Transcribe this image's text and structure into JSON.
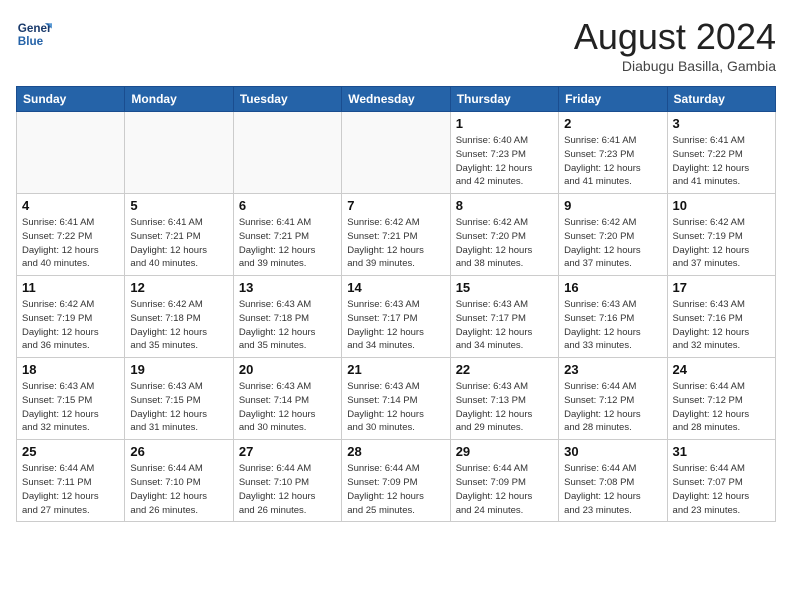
{
  "header": {
    "logo_line1": "General",
    "logo_line2": "Blue",
    "month_year": "August 2024",
    "location": "Diabugu Basilla, Gambia"
  },
  "weekdays": [
    "Sunday",
    "Monday",
    "Tuesday",
    "Wednesday",
    "Thursday",
    "Friday",
    "Saturday"
  ],
  "weeks": [
    [
      {
        "day": "",
        "info": ""
      },
      {
        "day": "",
        "info": ""
      },
      {
        "day": "",
        "info": ""
      },
      {
        "day": "",
        "info": ""
      },
      {
        "day": "1",
        "info": "Sunrise: 6:40 AM\nSunset: 7:23 PM\nDaylight: 12 hours\nand 42 minutes."
      },
      {
        "day": "2",
        "info": "Sunrise: 6:41 AM\nSunset: 7:23 PM\nDaylight: 12 hours\nand 41 minutes."
      },
      {
        "day": "3",
        "info": "Sunrise: 6:41 AM\nSunset: 7:22 PM\nDaylight: 12 hours\nand 41 minutes."
      }
    ],
    [
      {
        "day": "4",
        "info": "Sunrise: 6:41 AM\nSunset: 7:22 PM\nDaylight: 12 hours\nand 40 minutes."
      },
      {
        "day": "5",
        "info": "Sunrise: 6:41 AM\nSunset: 7:21 PM\nDaylight: 12 hours\nand 40 minutes."
      },
      {
        "day": "6",
        "info": "Sunrise: 6:41 AM\nSunset: 7:21 PM\nDaylight: 12 hours\nand 39 minutes."
      },
      {
        "day": "7",
        "info": "Sunrise: 6:42 AM\nSunset: 7:21 PM\nDaylight: 12 hours\nand 39 minutes."
      },
      {
        "day": "8",
        "info": "Sunrise: 6:42 AM\nSunset: 7:20 PM\nDaylight: 12 hours\nand 38 minutes."
      },
      {
        "day": "9",
        "info": "Sunrise: 6:42 AM\nSunset: 7:20 PM\nDaylight: 12 hours\nand 37 minutes."
      },
      {
        "day": "10",
        "info": "Sunrise: 6:42 AM\nSunset: 7:19 PM\nDaylight: 12 hours\nand 37 minutes."
      }
    ],
    [
      {
        "day": "11",
        "info": "Sunrise: 6:42 AM\nSunset: 7:19 PM\nDaylight: 12 hours\nand 36 minutes."
      },
      {
        "day": "12",
        "info": "Sunrise: 6:42 AM\nSunset: 7:18 PM\nDaylight: 12 hours\nand 35 minutes."
      },
      {
        "day": "13",
        "info": "Sunrise: 6:43 AM\nSunset: 7:18 PM\nDaylight: 12 hours\nand 35 minutes."
      },
      {
        "day": "14",
        "info": "Sunrise: 6:43 AM\nSunset: 7:17 PM\nDaylight: 12 hours\nand 34 minutes."
      },
      {
        "day": "15",
        "info": "Sunrise: 6:43 AM\nSunset: 7:17 PM\nDaylight: 12 hours\nand 34 minutes."
      },
      {
        "day": "16",
        "info": "Sunrise: 6:43 AM\nSunset: 7:16 PM\nDaylight: 12 hours\nand 33 minutes."
      },
      {
        "day": "17",
        "info": "Sunrise: 6:43 AM\nSunset: 7:16 PM\nDaylight: 12 hours\nand 32 minutes."
      }
    ],
    [
      {
        "day": "18",
        "info": "Sunrise: 6:43 AM\nSunset: 7:15 PM\nDaylight: 12 hours\nand 32 minutes."
      },
      {
        "day": "19",
        "info": "Sunrise: 6:43 AM\nSunset: 7:15 PM\nDaylight: 12 hours\nand 31 minutes."
      },
      {
        "day": "20",
        "info": "Sunrise: 6:43 AM\nSunset: 7:14 PM\nDaylight: 12 hours\nand 30 minutes."
      },
      {
        "day": "21",
        "info": "Sunrise: 6:43 AM\nSunset: 7:14 PM\nDaylight: 12 hours\nand 30 minutes."
      },
      {
        "day": "22",
        "info": "Sunrise: 6:43 AM\nSunset: 7:13 PM\nDaylight: 12 hours\nand 29 minutes."
      },
      {
        "day": "23",
        "info": "Sunrise: 6:44 AM\nSunset: 7:12 PM\nDaylight: 12 hours\nand 28 minutes."
      },
      {
        "day": "24",
        "info": "Sunrise: 6:44 AM\nSunset: 7:12 PM\nDaylight: 12 hours\nand 28 minutes."
      }
    ],
    [
      {
        "day": "25",
        "info": "Sunrise: 6:44 AM\nSunset: 7:11 PM\nDaylight: 12 hours\nand 27 minutes."
      },
      {
        "day": "26",
        "info": "Sunrise: 6:44 AM\nSunset: 7:10 PM\nDaylight: 12 hours\nand 26 minutes."
      },
      {
        "day": "27",
        "info": "Sunrise: 6:44 AM\nSunset: 7:10 PM\nDaylight: 12 hours\nand 26 minutes."
      },
      {
        "day": "28",
        "info": "Sunrise: 6:44 AM\nSunset: 7:09 PM\nDaylight: 12 hours\nand 25 minutes."
      },
      {
        "day": "29",
        "info": "Sunrise: 6:44 AM\nSunset: 7:09 PM\nDaylight: 12 hours\nand 24 minutes."
      },
      {
        "day": "30",
        "info": "Sunrise: 6:44 AM\nSunset: 7:08 PM\nDaylight: 12 hours\nand 23 minutes."
      },
      {
        "day": "31",
        "info": "Sunrise: 6:44 AM\nSunset: 7:07 PM\nDaylight: 12 hours\nand 23 minutes."
      }
    ]
  ]
}
